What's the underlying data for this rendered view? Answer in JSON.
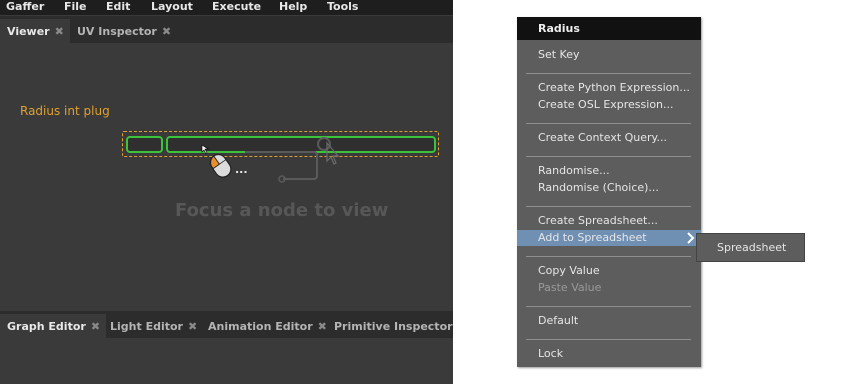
{
  "menubar": {
    "items": [
      "Gaffer",
      "File",
      "Edit",
      "Layout",
      "Execute",
      "Help",
      "Tools"
    ]
  },
  "top_tabs": [
    {
      "label": "Viewer",
      "close": "✖"
    },
    {
      "label": "UV Inspector",
      "close": "✖"
    }
  ],
  "viewer": {
    "annotation_label": "Radius int plug",
    "placeholder": "Focus a node to view",
    "ellipsis": "..."
  },
  "bottom_tabs": [
    {
      "label": "Graph Editor",
      "close": "✖"
    },
    {
      "label": "Light Editor",
      "close": "✖"
    },
    {
      "label": "Animation Editor",
      "close": "✖"
    },
    {
      "label": "Primitive Inspector",
      "close": "✖"
    }
  ],
  "context_menu": {
    "title": "Radius",
    "items": [
      {
        "label": "Set Key",
        "enabled": true
      },
      {
        "label": "Create Python Expression...",
        "enabled": true
      },
      {
        "label": "Create OSL Expression...",
        "enabled": true
      },
      {
        "label": "Create Context Query...",
        "enabled": true
      },
      {
        "label": "Randomise...",
        "enabled": true
      },
      {
        "label": "Randomise (Choice)...",
        "enabled": true
      },
      {
        "label": "Create Spreadsheet...",
        "enabled": true
      },
      {
        "label": "Add to Spreadsheet",
        "enabled": true,
        "highlighted": true,
        "submenu": true
      },
      {
        "label": "Copy Value",
        "enabled": true
      },
      {
        "label": "Paste Value",
        "enabled": false
      },
      {
        "label": "Default",
        "enabled": true
      },
      {
        "label": "Lock",
        "enabled": true
      }
    ],
    "submenu_arrow_icon": "chevron-right-icon"
  },
  "submenu": {
    "items": [
      {
        "label": "Spreadsheet"
      }
    ]
  },
  "colors": {
    "window_bg": "#3a3a3a",
    "menubar_bg": "#1e1e1e",
    "tabbar_bg": "#2c2c2c",
    "accent_orange": "#e0a030",
    "field_green": "#3cc33c",
    "menu_bg": "#5d5d5d",
    "menu_highlight": "#6f8fb3",
    "menu_title_bg": "#111111"
  }
}
